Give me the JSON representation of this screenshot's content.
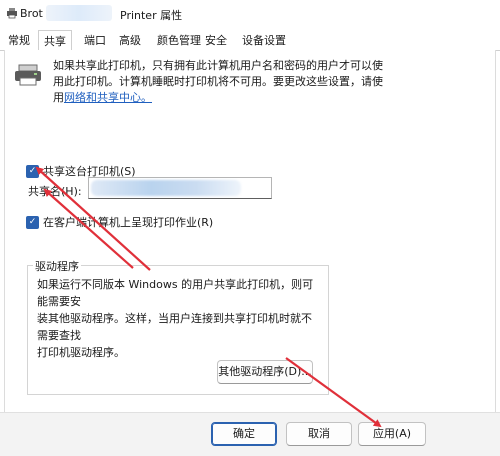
{
  "window": {
    "title_left": "Brot",
    "title_right": "Printer 属性"
  },
  "tabs": [
    {
      "label": "常规"
    },
    {
      "label": "共享"
    },
    {
      "label": "端口"
    },
    {
      "label": "高级"
    },
    {
      "label": "颜色管理"
    },
    {
      "label": "安全"
    },
    {
      "label": "设备设置"
    }
  ],
  "active_tab": "共享",
  "sharing": {
    "intro_line1": "如果共享此打印机，只有拥有此计算机用户名和密码的用户才可以使",
    "intro_line2": "用此打印机。计算机睡眠时打印机将不可用。要更改这些设置，请使",
    "intro_line3_prefix": "用",
    "intro_link": "网络和共享中心。",
    "share_checkbox_label": "共享这台打印机(S)",
    "share_checkbox_checked": true,
    "share_name_label": "共享名(H):",
    "share_name_value": "",
    "render_checkbox_label": "在客户端计算机上呈现打印作业(R)",
    "render_checkbox_checked": true
  },
  "drivers": {
    "group_title": "驱动程序",
    "text_line1": "如果运行不同版本 Windows 的用户共享此打印机，则可能需要安",
    "text_line2": "装其他驱动程序。这样，当用户连接到共享打印机时就不需要查找",
    "text_line3": "打印机驱动程序。",
    "button": "其他驱动程序(D)..."
  },
  "footer": {
    "ok": "确定",
    "cancel": "取消",
    "apply": "应用(A)"
  },
  "colors": {
    "annotation_arrow": "#e0303a",
    "checkbox": "#2b62b0",
    "link": "#1f5fbf"
  }
}
